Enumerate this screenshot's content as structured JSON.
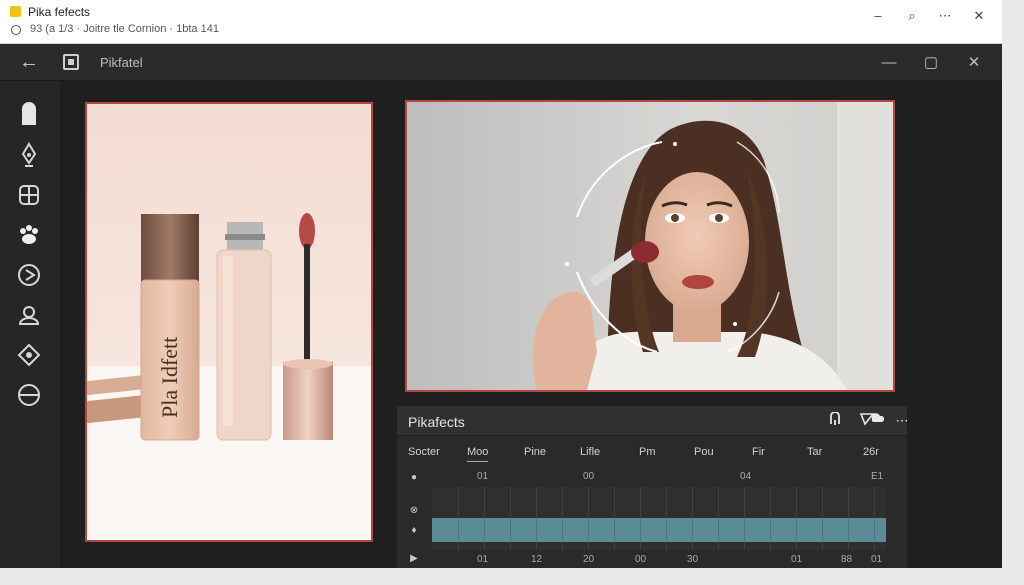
{
  "browser": {
    "title": "Pika fefects",
    "subtitle": "93 (a 1/3  ·  Joitre tle Cornion  ·  1bta 141",
    "controls": [
      "–",
      "⌕",
      "⋯",
      "✕"
    ]
  },
  "app": {
    "title": "Pikfatel",
    "window_controls": [
      "—",
      "▢",
      "✕"
    ]
  },
  "sidebar": {
    "icons": [
      "bookmark-icon",
      "pen-nib-icon",
      "grid-icon",
      "paw-icon",
      "play-circle-icon",
      "user-icon",
      "target-icon",
      "half-circle-icon"
    ]
  },
  "left_panel": {
    "product_label": "Pla Idfett"
  },
  "timeline": {
    "title": "Pikafects",
    "tools": [
      "pin-icon",
      "arrow-tool-icon",
      "shape-icon",
      "more-icon"
    ],
    "tabs": [
      "Socter",
      "Moo",
      "Pine",
      "Lifle",
      "Pm",
      "Pou",
      "Fir",
      "Tar",
      "26r"
    ],
    "active_tab": "Moo",
    "ruler_top": [
      "01",
      "00",
      "04",
      "E1"
    ],
    "ruler_bottom": [
      "01",
      "12",
      "20",
      "00",
      "30",
      "01",
      "88",
      "01"
    ]
  },
  "colors": {
    "accent_border": "#b5483e",
    "clip": "#5a8c95"
  }
}
